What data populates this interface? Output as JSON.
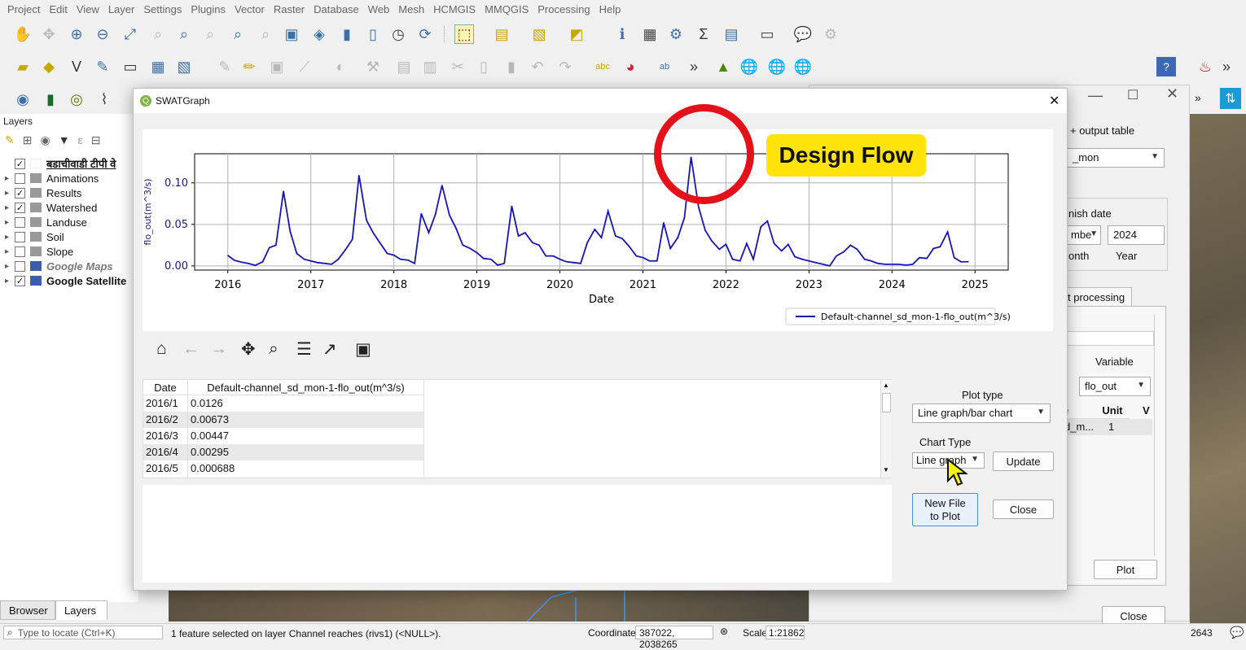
{
  "menu": [
    "Project",
    "Edit",
    "View",
    "Layer",
    "Settings",
    "Plugins",
    "Vector",
    "Raster",
    "Database",
    "Web",
    "Mesh",
    "HCMGIS",
    "MMQGIS",
    "Processing",
    "Help"
  ],
  "layers_panel": {
    "title": "Layers",
    "items": [
      {
        "label": "बडाचीवाडी टीपी वे",
        "checked": true
      },
      {
        "label": "Animations",
        "checked": false
      },
      {
        "label": "Results",
        "checked": true
      },
      {
        "label": "Watershed",
        "checked": true
      },
      {
        "label": "Landuse",
        "checked": false
      },
      {
        "label": "Soil",
        "checked": false
      },
      {
        "label": "Slope",
        "checked": false
      },
      {
        "label": "Google Maps",
        "checked": false
      },
      {
        "label": "Google Satellite",
        "checked": true
      }
    ]
  },
  "bottom_tabs": {
    "browser": "Browser",
    "layers": "Layers"
  },
  "status": {
    "locate_placeholder": "Type to locate (Ctrl+K)",
    "message": "1 feature selected on layer Channel reaches (rivs1) (<NULL>).",
    "coordinate_label": "Coordinate",
    "coordinate_value": "387022, 2038265",
    "scale_label": "Scale",
    "scale_value": "1:21862",
    "right_fragment": "2643"
  },
  "bg_dialog": {
    "output_table_label": "+ output table",
    "output_table_value": "_mon",
    "finish_date_label": "nish date",
    "month_value": "mbe",
    "year_value": "2024",
    "month_label": "onth",
    "year_label": "Year",
    "tab_label": "t processing",
    "variable_label": "Variable",
    "variable_value": "flo_out",
    "col_e": "e",
    "col_unit": "Unit",
    "col_v": "V",
    "row_name": "d_m...",
    "row_unit": "1",
    "plot_button": "Plot",
    "close_button": "Close"
  },
  "dialog": {
    "title": "SWATGraph",
    "table_headers": [
      "Date",
      "Default-channel_sd_mon-1-flo_out(m^3/s)"
    ],
    "rows": [
      [
        "2016/1",
        "0.0126"
      ],
      [
        "2016/2",
        "0.00673"
      ],
      [
        "2016/3",
        "0.00447"
      ],
      [
        "2016/4",
        "0.00295"
      ],
      [
        "2016/5",
        "0.000688"
      ]
    ],
    "plot_type_label": "Plot type",
    "plot_type_value": "Line graph/bar chart",
    "chart_type_label": "Chart Type",
    "chart_type_value": "Line graph",
    "update_button": "Update",
    "new_file_button": "New File\nto Plot",
    "close_button": "Close"
  },
  "annotation": {
    "callout": "Design Flow"
  },
  "chart_data": {
    "type": "line",
    "title": "",
    "xlabel": "Date",
    "ylabel": "flo_out(m^3/s)",
    "xlim": [
      2015.6,
      2025.4
    ],
    "ylim": [
      -0.005,
      0.135
    ],
    "xticks": [
      "2016",
      "2017",
      "2018",
      "2019",
      "2020",
      "2021",
      "2022",
      "2023",
      "2024",
      "2025"
    ],
    "yticks": [
      "0.00",
      "0.05",
      "0.10"
    ],
    "legend": "bottom-right",
    "grid": true,
    "color": "#1515b5",
    "series": [
      {
        "name": "Default-channel_sd_mon-1-flo_out(m^3/s)",
        "x": [
          2016.0,
          2016.08,
          2016.17,
          2016.25,
          2016.33,
          2016.42,
          2016.5,
          2016.58,
          2016.67,
          2016.75,
          2016.83,
          2016.92,
          2017.0,
          2017.08,
          2017.17,
          2017.25,
          2017.33,
          2017.42,
          2017.5,
          2017.58,
          2017.67,
          2017.75,
          2017.83,
          2017.92,
          2018.0,
          2018.08,
          2018.17,
          2018.25,
          2018.33,
          2018.42,
          2018.5,
          2018.58,
          2018.67,
          2018.75,
          2018.83,
          2018.92,
          2019.0,
          2019.08,
          2019.17,
          2019.25,
          2019.33,
          2019.42,
          2019.5,
          2019.58,
          2019.67,
          2019.75,
          2019.83,
          2019.92,
          2020.0,
          2020.08,
          2020.17,
          2020.25,
          2020.33,
          2020.42,
          2020.5,
          2020.58,
          2020.67,
          2020.75,
          2020.83,
          2020.92,
          2021.0,
          2021.08,
          2021.17,
          2021.25,
          2021.33,
          2021.42,
          2021.5,
          2021.58,
          2021.67,
          2021.75,
          2021.83,
          2021.92,
          2022.0,
          2022.08,
          2022.17,
          2022.25,
          2022.33,
          2022.42,
          2022.5,
          2022.58,
          2022.67,
          2022.75,
          2022.83,
          2022.92,
          2023.0,
          2023.08,
          2023.17,
          2023.25,
          2023.33,
          2023.42,
          2023.5,
          2023.58,
          2023.67,
          2023.75,
          2023.83,
          2023.92,
          2024.0,
          2024.08,
          2024.17,
          2024.25,
          2024.33,
          2024.42,
          2024.5,
          2024.58,
          2024.67,
          2024.75,
          2024.83,
          2024.92
        ],
        "y": [
          0.0126,
          0.00673,
          0.00447,
          0.00295,
          0.000688,
          0.005,
          0.022,
          0.025,
          0.09,
          0.042,
          0.015,
          0.008,
          0.006,
          0.004,
          0.003,
          0.002,
          0.008,
          0.02,
          0.032,
          0.109,
          0.055,
          0.04,
          0.028,
          0.015,
          0.013,
          0.008,
          0.007,
          0.003,
          0.063,
          0.04,
          0.062,
          0.097,
          0.061,
          0.045,
          0.025,
          0.021,
          0.016,
          0.009,
          0.008,
          0.001,
          0.003,
          0.072,
          0.036,
          0.04,
          0.028,
          0.025,
          0.012,
          0.012,
          0.008,
          0.005,
          0.004,
          0.003,
          0.028,
          0.044,
          0.034,
          0.066,
          0.036,
          0.033,
          0.024,
          0.012,
          0.01,
          0.006,
          0.006,
          0.052,
          0.021,
          0.034,
          0.058,
          0.131,
          0.071,
          0.043,
          0.03,
          0.02,
          0.026,
          0.008,
          0.006,
          0.027,
          0.008,
          0.047,
          0.054,
          0.027,
          0.018,
          0.026,
          0.011,
          0.008,
          0.006,
          0.004,
          0.002,
          0.0,
          0.012,
          0.017,
          0.025,
          0.02,
          0.008,
          0.006,
          0.003,
          0.002,
          0.002,
          0.002,
          0.001,
          0.002,
          0.01,
          0.009,
          0.021,
          0.023,
          0.041,
          0.01,
          0.005,
          0.005
        ]
      }
    ]
  }
}
